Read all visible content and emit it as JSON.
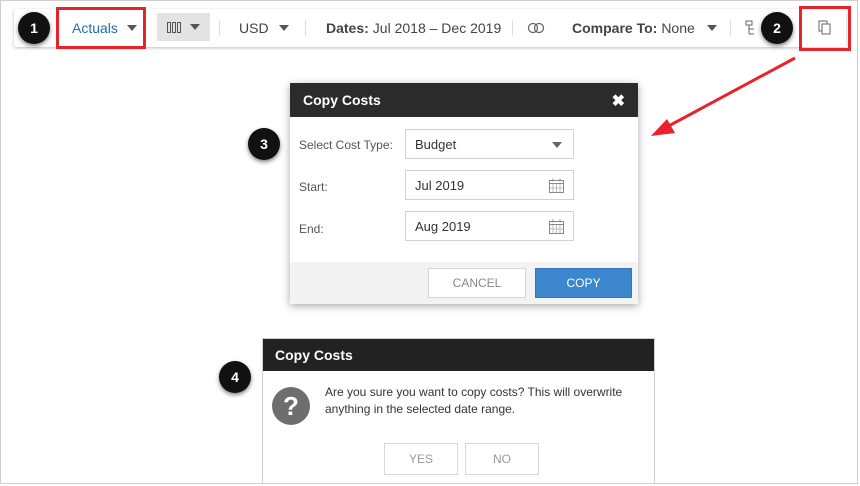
{
  "toolbar": {
    "view_label": "Actuals",
    "currency": "USD",
    "dates_label": "Dates:",
    "dates_value": "Jul 2018 – Dec 2019",
    "compare_label": "Compare To:",
    "compare_value": "None"
  },
  "annotations": {
    "step1": "1",
    "step2": "2",
    "step3": "3",
    "step4": "4",
    "highlight_color": "#e8232a"
  },
  "copy_dialog": {
    "title": "Copy Costs",
    "cost_type_label": "Select Cost Type:",
    "cost_type_value": "Budget",
    "start_label": "Start:",
    "start_value": "Jul 2019",
    "end_label": "End:",
    "end_value": "Aug 2019",
    "cancel_label": "CANCEL",
    "copy_label": "COPY",
    "accent_color": "#3b86cc"
  },
  "confirm_dialog": {
    "title": "Copy Costs",
    "message": "Are you sure you want to copy costs? This will overwrite anything in the selected date range.",
    "yes_label": "YES",
    "no_label": "NO"
  },
  "icons": [
    "columns-icon",
    "calculator-icon",
    "hierarchy-icon",
    "copy-icon",
    "close-icon",
    "calendar-icon",
    "question-icon"
  ]
}
